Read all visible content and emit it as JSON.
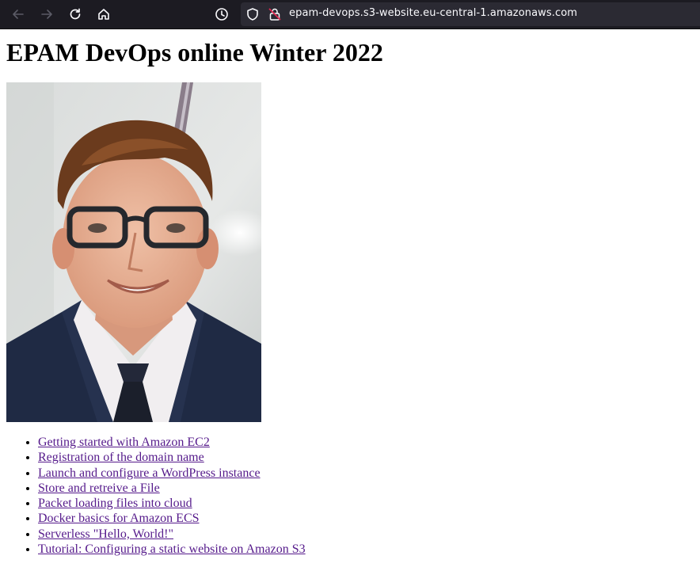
{
  "browser": {
    "url": "epam-devops.s3-website.eu-central-1.amazonaws.com",
    "icons": [
      "back-arrow-icon",
      "forward-arrow-icon",
      "reload-icon",
      "home-icon",
      "clock-icon",
      "shield-icon",
      "insecure-lock-icon"
    ]
  },
  "page": {
    "title": "EPAM DevOps online Winter 2022",
    "links": [
      "Getting started with Amazon EC2",
      "Registration of the domain name",
      "Launch and configure a WordPress instance",
      "Store and retreive a File",
      "Packet loading files into cloud",
      "Docker basics for Amazon ECS",
      "Serverless \"Hello, World!\"",
      "Tutorial: Configuring a static website on Amazon S3"
    ]
  },
  "colors": {
    "toolbar_bg": "#1c1b22",
    "visited_link": "#551a8b"
  }
}
